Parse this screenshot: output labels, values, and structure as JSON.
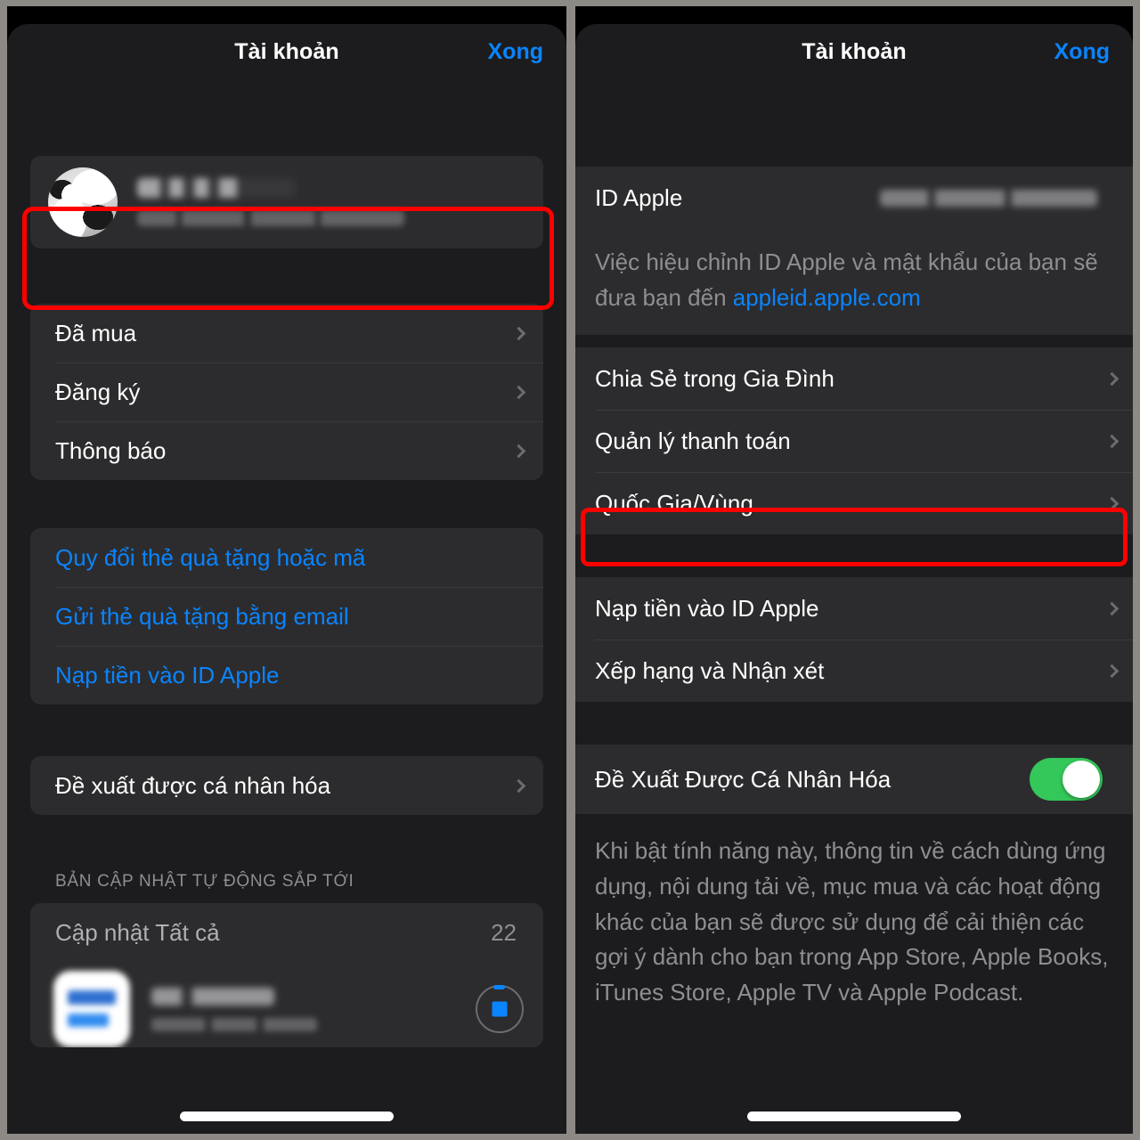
{
  "left": {
    "navbar": {
      "title": "Tài khoản",
      "action": "Xong"
    },
    "account": {
      "name_redacted": "",
      "email_redacted": ""
    },
    "group_menu": [
      {
        "label": "Đã mua",
        "chevron": "chevron-right-icon"
      },
      {
        "label": "Đăng ký",
        "chevron": "chevron-right-icon"
      },
      {
        "label": "Thông báo",
        "chevron": "chevron-right-icon"
      }
    ],
    "group_links": [
      {
        "label": "Quy đổi thẻ quà tặng hoặc mã"
      },
      {
        "label": "Gửi thẻ quà tặng bằng email"
      },
      {
        "label": "Nạp tiền vào ID Apple"
      }
    ],
    "group_personalized": [
      {
        "label": "Đề xuất được cá nhân hóa",
        "chevron": "chevron-right-icon"
      }
    ],
    "updates_header": "BẢN CẬP NHẬT TỰ ĐỘNG SẮP TỚI",
    "update_all": {
      "label": "Cập nhật Tất cả",
      "count": "22"
    },
    "update_item": {
      "name_redacted": "",
      "subtitle_redacted": "",
      "icon": "app-icon-acb-one",
      "progress": "stop-download-icon"
    }
  },
  "right": {
    "navbar": {
      "title": "Tài khoản",
      "action": "Xong"
    },
    "apple_id_row": {
      "label": "ID Apple",
      "value_redacted": ""
    },
    "apple_id_footer_pre": "Việc hiệu chỉnh ID Apple và mật khẩu của bạn sẽ đưa bạn đến ",
    "apple_id_footer_link": "appleid.apple.com",
    "group_account": [
      {
        "label": "Chia Sẻ trong Gia Đình",
        "chevron": "chevron-right-icon"
      },
      {
        "label": "Quản lý thanh toán",
        "chevron": "chevron-right-icon"
      },
      {
        "label": "Quốc Gia/Vùng",
        "chevron": "chevron-right-icon"
      }
    ],
    "group_money": [
      {
        "label": "Nạp tiền vào ID Apple",
        "chevron": "chevron-right-icon"
      },
      {
        "label": "Xếp hạng và Nhận xét",
        "chevron": "chevron-right-icon"
      }
    ],
    "personalized_toggle": {
      "label": "Đề Xuất Được Cá Nhân Hóa",
      "state": "on"
    },
    "personalized_desc": "Khi bật tính năng này, thông tin về cách dùng ứng dụng, nội dung tải về, mục mua và các hoạt động khác của bạn sẽ được sử dụng để cải thiện các gợi ý dành cho bạn trong App Store, Apple Books, iTunes Store, Apple TV và Apple Podcast."
  },
  "annotations": {
    "highlight_color": "#fe0000",
    "boxes": [
      {
        "name": "account-row-highlight",
        "target": "left account row"
      },
      {
        "name": "country-region-highlight",
        "target": "right Quốc Gia/Vùng row"
      }
    ]
  },
  "theme": {
    "accent_blue": "#0a84ff",
    "toggle_green": "#34c759",
    "card_bg": "#2c2c2e",
    "page_bg": "#1c1c1e",
    "secondary_text": "#8e8e93"
  }
}
